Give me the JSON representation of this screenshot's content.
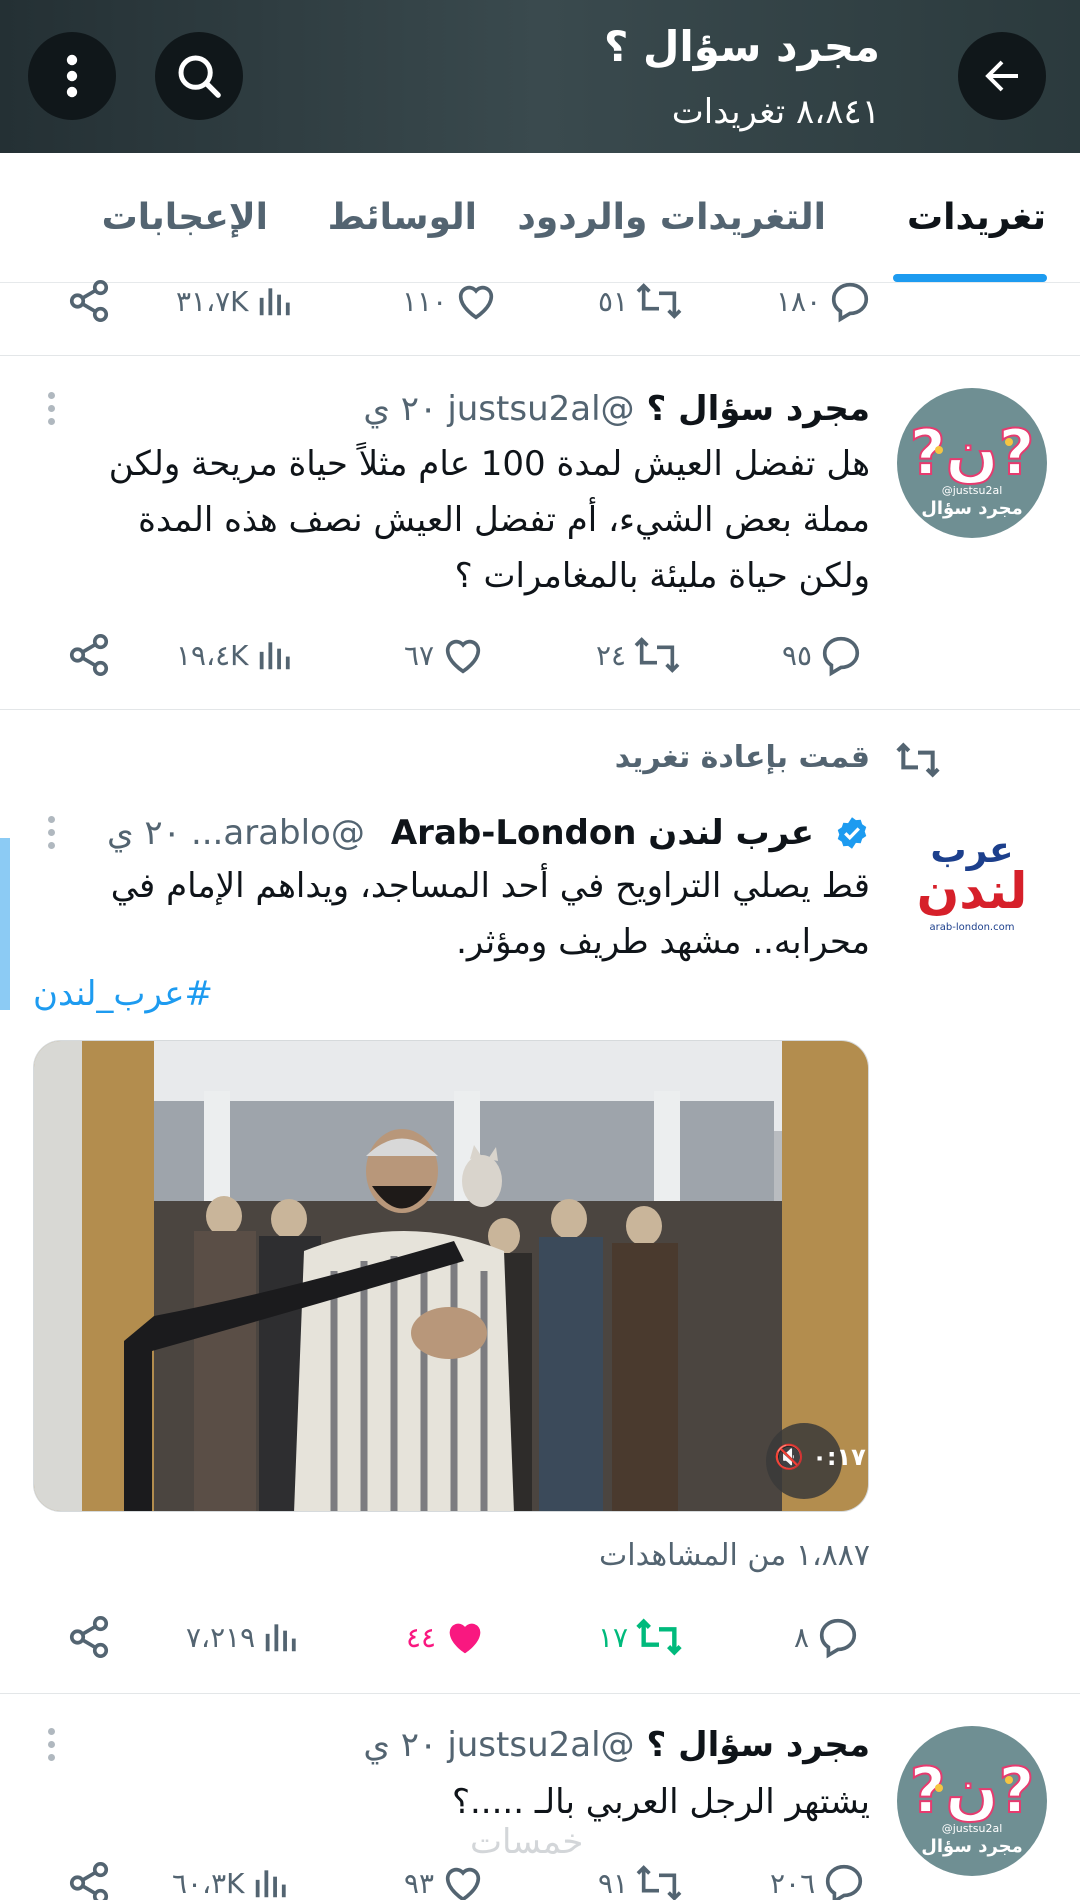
{
  "header": {
    "title": "مجرد سؤال ؟",
    "subtitle": "٨،٨٤١ تغريدات",
    "back_icon": "arrow-left-icon",
    "search_icon": "search-icon",
    "more_icon": "more-vertical-icon",
    "background": "#2e3c40"
  },
  "tabs": [
    {
      "label": "تغريدات",
      "active": true
    },
    {
      "label": "التغريدات والردود",
      "active": false
    },
    {
      "label": "الوسائط",
      "active": false
    },
    {
      "label": "الإعجابات",
      "active": false
    }
  ],
  "accent": "#1d9bf0",
  "partial_tweet": {
    "replies": "١٨٠",
    "retweets": "٥١",
    "likes": "١١٠",
    "views": "٣١،٧K"
  },
  "tweet1": {
    "name": "مجرد سؤال ؟",
    "handle": "@justsu2al",
    "time": "٢٠ ي",
    "avatar_text": "@justsu2al",
    "avatar_label": "مجرد سؤال",
    "text": "هل تفضل العيش لمدة 100 عام مثلاً حياة مريحة ولكن مملة بعض الشيء، أم تفضل العيش نصف هذه المدة ولكن حياة مليئة بالمغامرات ؟",
    "replies": "٩٥",
    "retweets": "٢٤",
    "likes": "٦٧",
    "views": "١٩،٤K"
  },
  "tweet2": {
    "retweeted_label": "قمت بإعادة تغريد",
    "name": "عرب لندن Arab-London",
    "handle": "@arablo...",
    "time": "٢٠ ي",
    "verified": true,
    "avatar_top": "عرب",
    "avatar_main": "لندن",
    "avatar_url": "arab-london.com",
    "text": "قط يصلي التراويح في أحد المساجد، ويداهم الإمام في محرابه.. مشهد طريف ومؤثر.",
    "hashtag": "#عرب_لندن",
    "video_duration": "٠:١٧",
    "views_count": "١،٨٨٧ من المشاهدات",
    "replies": "٨",
    "retweets": "١٧",
    "likes": "٤٤",
    "views": "٧،٢١٩",
    "like_color": "#f91880",
    "retweet_color": "#00ba7c"
  },
  "tweet3": {
    "name": "مجرد سؤال ؟",
    "handle": "@justsu2al",
    "time": "٢٠ ي",
    "avatar_text": "@justsu2al",
    "avatar_label": "مجرد سؤال",
    "text": "يشتهر الرجل العربي بالـ .....؟",
    "replies": "٢٠٦",
    "retweets": "٩١",
    "likes": "٩٣",
    "views": "٦٠،٣K"
  },
  "watermark": "خمسات"
}
